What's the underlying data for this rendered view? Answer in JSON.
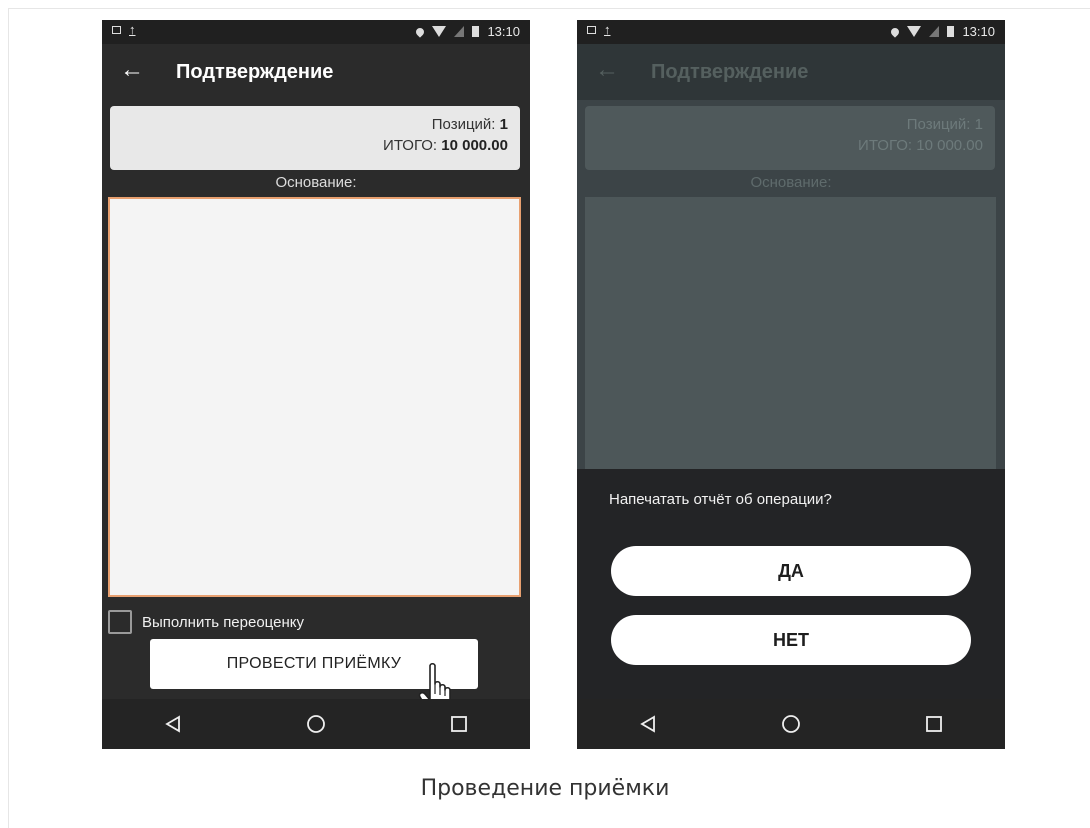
{
  "caption": "Проведение приёмки",
  "status_time": "13:10",
  "screen1": {
    "title": "Подтверждение",
    "positions_label": "Позиций:",
    "positions_value": "1",
    "total_label": "ИТОГО:",
    "total_value": "10 000.00",
    "basis_label": "Основание:",
    "basis_value": "",
    "checkbox_label": "Выполнить переоценку",
    "checkbox_checked": false,
    "primary_button": "ПРОВЕСТИ ПРИЁМКУ"
  },
  "screen2": {
    "title": "Подтверждение",
    "positions_label": "Позиций:",
    "positions_value": "1",
    "total_label": "ИТОГО:",
    "total_value": "10 000.00",
    "basis_label": "Основание:",
    "dialog_question": "Напечатать отчёт об операции?",
    "yes_button": "ДА",
    "no_button": "НЕТ"
  },
  "icons": {
    "status_left": [
      "image-icon",
      "upload-icon"
    ],
    "status_right": [
      "location-icon",
      "wifi-icon",
      "signal-icon",
      "battery-icon"
    ],
    "nav": [
      "back-triangle-icon",
      "home-circle-icon",
      "recents-square-icon"
    ]
  },
  "colors": {
    "screen_bg": "#2b2b2b",
    "basis_border": "#e8a070",
    "dialog_bg": "#232426",
    "dim_overlay": "#3c4447"
  }
}
